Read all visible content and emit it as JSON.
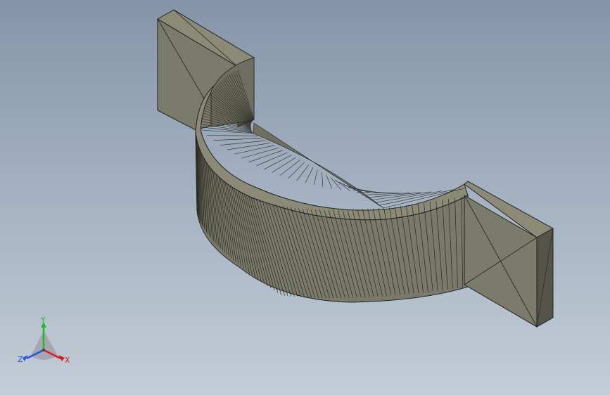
{
  "triad": {
    "x_label": "X",
    "y_label": "Y",
    "z_label": "Z"
  },
  "colors": {
    "background_top": "#8594a8",
    "background_bottom": "#c4cdd7",
    "model_face": "#7b7b6b",
    "model_face_light": "#86866f",
    "model_face_dark": "#545448",
    "edge_line": "#222218",
    "axis_x": "#d22020",
    "axis_y": "#22bb22",
    "axis_z": "#2255dd"
  }
}
